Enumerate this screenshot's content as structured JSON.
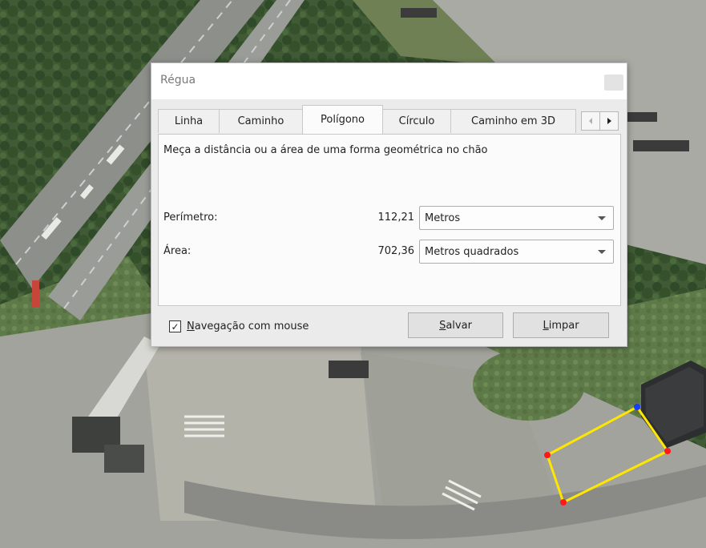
{
  "dialog": {
    "title": "Régua",
    "tabs": [
      {
        "label": "Linha"
      },
      {
        "label": "Caminho"
      },
      {
        "label": "Polígono",
        "active": true
      },
      {
        "label": "Círculo"
      },
      {
        "label": "Caminho em 3D"
      }
    ],
    "description": "Meça a distância ou a área de uma forma geométrica no chão",
    "perimeter": {
      "label": "Perímetro:",
      "value": "112,21",
      "unit": "Metros"
    },
    "area": {
      "label": "Área:",
      "value": "702,36",
      "unit": "Metros quadrados"
    },
    "mouse_navigation": {
      "checked": true,
      "mark": "✓",
      "first_letter": "N",
      "rest": "avegação com mouse"
    },
    "save_button": {
      "first_letter": "S",
      "rest": "alvar"
    },
    "clear_button": {
      "first_letter": "L",
      "rest": "impar"
    }
  },
  "map": {
    "polygon_color": "#ffe600",
    "vertex_color": "#ff1a1a",
    "active_vertex_color": "#1a3cff"
  },
  "icons": [
    "close-icon",
    "scroll-left-icon",
    "scroll-right-icon",
    "dropdown-arrow-icon",
    "checkmark-icon"
  ]
}
